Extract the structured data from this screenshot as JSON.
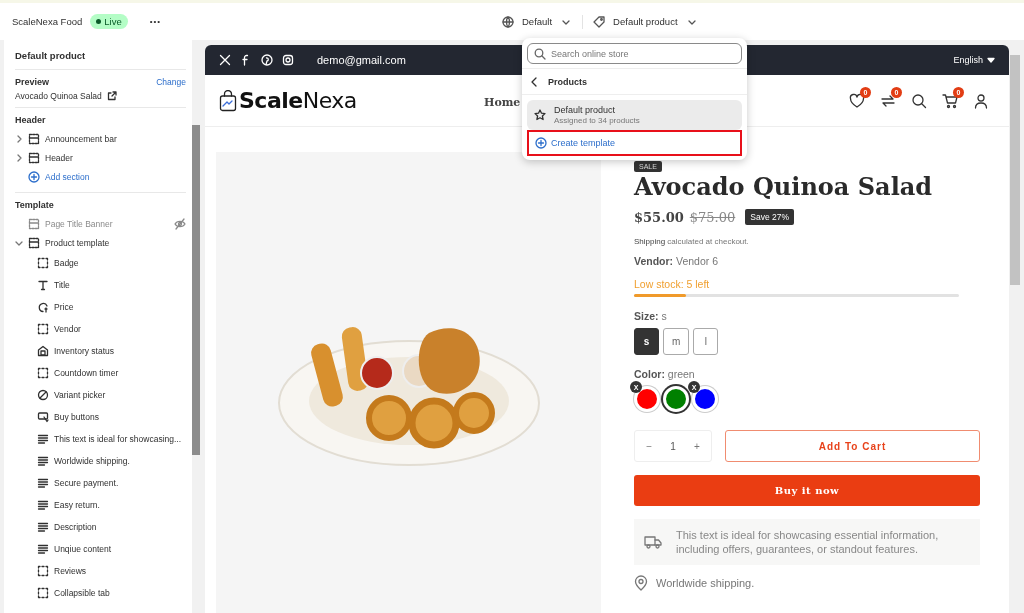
{
  "topbar": {
    "store_name": "ScaleNexa Food",
    "status": "Live",
    "live": true,
    "more": "•••",
    "theme": "Default",
    "template": "Default product"
  },
  "sidebar": {
    "title": "Default product",
    "preview_label": "Preview",
    "change": "Change",
    "preview_product": "Avocado Quinoa Salad",
    "header_group": {
      "title": "Header",
      "items": [
        {
          "label": "Announcement bar",
          "expanded": false
        },
        {
          "label": "Header",
          "expanded": false
        }
      ],
      "add_section": "Add section"
    },
    "template_group": {
      "title": "Template",
      "items": [
        {
          "label": "Page Title Banner",
          "hidden": true,
          "expanded": false
        },
        {
          "label": "Product template",
          "hidden": false,
          "expanded": true,
          "children": [
            {
              "label": "Badge",
              "kind": "block"
            },
            {
              "label": "Title",
              "kind": "text"
            },
            {
              "label": "Price",
              "kind": "price"
            },
            {
              "label": "Vendor",
              "kind": "block"
            },
            {
              "label": "Inventory status",
              "kind": "inventory"
            },
            {
              "label": "Countdown timer",
              "kind": "block"
            },
            {
              "label": "Variant picker",
              "kind": "variant"
            },
            {
              "label": "Buy buttons",
              "kind": "buy"
            },
            {
              "label": "This text is ideal for showcasing...",
              "kind": "paragraph"
            },
            {
              "label": "Worldwide shipping.",
              "kind": "paragraph"
            },
            {
              "label": "Secure payment.",
              "kind": "paragraph"
            },
            {
              "label": "Easy return.",
              "kind": "paragraph"
            },
            {
              "label": "Description",
              "kind": "paragraph"
            },
            {
              "label": "Unqiue content",
              "kind": "paragraph"
            },
            {
              "label": "Reviews",
              "kind": "block"
            },
            {
              "label": "Collapsible tab",
              "kind": "block"
            }
          ]
        }
      ]
    }
  },
  "store": {
    "announcement": {
      "email": "demo@gmail.com",
      "language": "English"
    },
    "header": {
      "logo": "**Scale**Nexa",
      "nav": [
        "Home"
      ],
      "wishlist_count": "0",
      "compare_count": "0",
      "cart_count": "0"
    },
    "product": {
      "badge": "SALE",
      "title": "Avocado Quinoa Salad",
      "price": "$55.00",
      "compare_price": "$75.00",
      "save": "Save 27%",
      "shipping_link": "Shipping",
      "shipping_text": "calculated at checkout.",
      "vendor_label": "Vendor:",
      "vendor": "Vendor 6",
      "stock": "Low stock: 5 left",
      "stock_level": {
        "level": 0.16
      },
      "size_label": "Size:",
      "size_value": "s",
      "sizes": [
        {
          "label": "s",
          "selected": true
        },
        {
          "label": "m",
          "selected": false
        },
        {
          "label": "l",
          "selected": false
        }
      ],
      "color_label": "Color:",
      "color_value": "green",
      "swatches": [
        {
          "color": "#ff0000",
          "selected": false,
          "unavailable": true,
          "mark": "X"
        },
        {
          "color": "#008000",
          "selected": true,
          "unavailable": false
        },
        {
          "color": "#0000ff",
          "selected": false,
          "unavailable": true,
          "mark": "X"
        }
      ],
      "quantity": "1",
      "minus": "−",
      "plus": "+",
      "add_to_cart": "Add To Cart",
      "buy_now": "Buy it now",
      "info": "This text is ideal for showcasing essential information, including offers, guarantees, or standout features.",
      "feature": "Worldwide shipping."
    }
  },
  "dropdown": {
    "search_placeholder": "Search online store",
    "back": "Products",
    "items": [
      {
        "title": "Default product",
        "subtitle": "Assigned to 34 products",
        "selected": true
      }
    ],
    "create": "Create template",
    "create_highlighted": true
  }
}
